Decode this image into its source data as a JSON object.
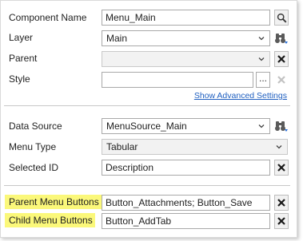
{
  "properties": {
    "component_name": {
      "label": "Component Name",
      "value": "Menu_Main"
    },
    "layer": {
      "label": "Layer",
      "value": "Main"
    },
    "parent": {
      "label": "Parent",
      "value": ""
    },
    "style": {
      "label": "Style",
      "value": "",
      "browse_label": "..."
    },
    "show_advanced_label": "Show Advanced Settings"
  },
  "data": {
    "data_source": {
      "label": "Data Source",
      "value": "MenuSource_Main"
    },
    "menu_type": {
      "label": "Menu Type",
      "value": "Tabular"
    },
    "selected_id": {
      "label": "Selected ID",
      "value": "Description"
    }
  },
  "buttons": {
    "parent_menu_buttons": {
      "label": "Parent Menu Buttons",
      "value": "Button_Attachments; Button_Save"
    },
    "child_menu_buttons": {
      "label": "Child Menu Buttons",
      "value": "Button_AddTab"
    }
  },
  "colors": {
    "highlight": "#fbf87a",
    "link": "#1f5fc0",
    "clear_icon": "#1a1a1a",
    "disabled_icon": "#c2c2c2"
  }
}
